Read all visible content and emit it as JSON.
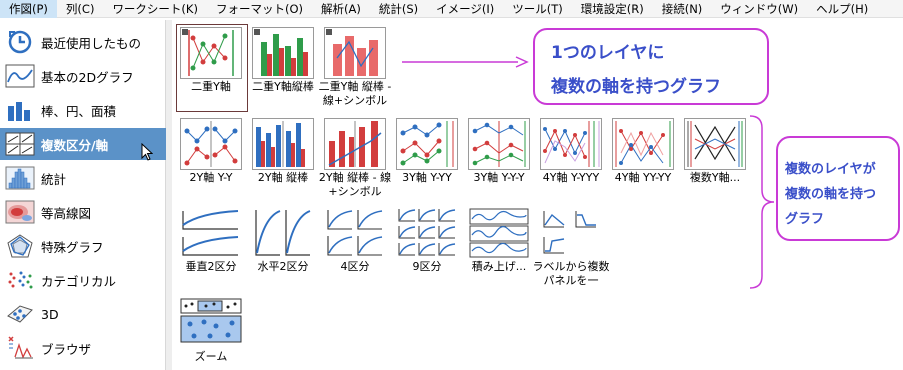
{
  "menubar": {
    "items": [
      "作図(P)",
      "列(C)",
      "ワークシート(K)",
      "フォーマット(O)",
      "解析(A)",
      "統計(S)",
      "イメージ(I)",
      "ツール(T)",
      "環境設定(R)",
      "接続(N)",
      "ウィンドウ(W)",
      "ヘルプ(H)"
    ]
  },
  "sidebar": {
    "items": [
      "最近使用したもの",
      "基本の2Dグラフ",
      "棒、円、面積",
      "複数区分/軸",
      "統計",
      "等高線図",
      "特殊グラフ",
      "カテゴリカル",
      "3D",
      "ブラウザ"
    ],
    "selected": "複数区分/軸"
  },
  "gallery": {
    "row1": [
      "二重Y軸",
      "二重Y軸縦棒",
      "二重Y軸 縦棒 - 線+シンボル"
    ],
    "row2": [
      "2Y軸 Y-Y",
      "2Y軸 縦棒",
      "2Y軸 縦棒 - 線+シンボル",
      "3Y軸 Y-YY",
      "3Y軸 Y-Y-Y",
      "4Y軸 Y-YYY",
      "4Y軸 YY-YY",
      "複数Y軸..."
    ],
    "row3": [
      "垂直2区分",
      "水平2区分",
      "4区分",
      "9区分",
      "積み上げ...",
      "ラベルから複数パネルを一"
    ],
    "row4": [
      "ズーム"
    ]
  },
  "callouts": {
    "single_layer_line1": "1つのレイヤに",
    "single_layer_line2": "複数の軸を持つグラフ",
    "multi_layer_line1": "複数のレイヤが",
    "multi_layer_line2": "複数の軸を持つ",
    "multi_layer_line3": "グラフ"
  },
  "colors": {
    "selected_bg": "#5b92c8",
    "annotation": "#c93ad6",
    "annotation_text": "#3a4fc9",
    "plot_blue": "#2e6fd1",
    "plot_red": "#e03030",
    "plot_green": "#2f9c4a"
  }
}
